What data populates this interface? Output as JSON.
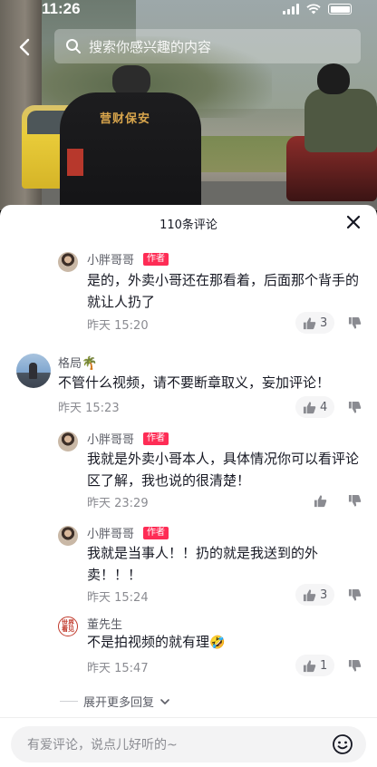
{
  "status_bar": {
    "time": "11:26"
  },
  "search": {
    "placeholder": "搜索你感兴趣的内容"
  },
  "video": {
    "guard_vest_text": "营财保安"
  },
  "sheet": {
    "title": "110条评论"
  },
  "comments": [
    {
      "user": "小胖哥哥",
      "tag": "作者",
      "text": "是的，外卖小哥还在那看着，后面那个背手的就让人扔了",
      "time": "昨天 15:20",
      "likes": "3"
    },
    {
      "user": "格局",
      "user_emoji": "🌴",
      "text": "不管什么视频，请不要断章取义，妄加评论！",
      "time": "昨天 15:23",
      "likes": "4"
    },
    {
      "user": "小胖哥哥",
      "tag": "作者",
      "text": "我就是外卖小哥本人，具体情况你可以看评论区了解，我也说的很清楚！",
      "time": "昨天 23:29",
      "likes": ""
    },
    {
      "user": "小胖哥哥",
      "tag": "作者",
      "text": "我就是当事人！！扔的就是我送到的外卖！！！",
      "time": "昨天 15:24",
      "likes": "3"
    },
    {
      "user": "董先生",
      "avatar_text": "世界 看见",
      "text": "不是拍视频的就有理",
      "text_emoji": "🤣",
      "time": "昨天 15:47",
      "likes": "1"
    }
  ],
  "expand": {
    "label": "展开更多回复"
  },
  "input": {
    "placeholder": "有爱评论，说点儿好听的~"
  },
  "icons": {
    "back": "chevron-left-icon",
    "search": "search-icon",
    "close": "close-icon",
    "like": "thumb-up-icon",
    "dislike": "thumb-down-icon",
    "emoji": "smiley-icon",
    "expand": "chevron-down-icon"
  },
  "colors": {
    "author_tag": "#fe2c55",
    "text": "#161823",
    "muted": "#8a8b91"
  }
}
